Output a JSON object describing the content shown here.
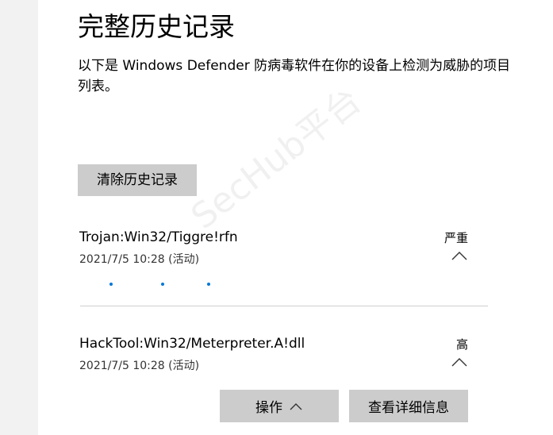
{
  "page": {
    "title": "完整历史记录",
    "description": "以下是 Windows Defender 防病毒软件在你的设备上检测为威胁的项目列表。"
  },
  "toolbar": {
    "clear_label": "清除历史记录"
  },
  "threats": [
    {
      "name": "Trojan:Win32/Tiggre!rfn",
      "date": "2021/7/5 10:28 (活动)",
      "severity": "严重",
      "expanded": false
    },
    {
      "name": "HackTool:Win32/Meterpreter.A!dll",
      "date": "2021/7/5 10:28 (活动)",
      "severity": "高",
      "expanded": true
    }
  ],
  "actions": {
    "actions_label": "操作",
    "details_label": "查看详细信息"
  },
  "watermark": {
    "text": "SecHub平台"
  },
  "colors": {
    "accent": "#0078d7",
    "button_bg": "#cccccc",
    "sidebar_bg": "#f2f2f2"
  }
}
